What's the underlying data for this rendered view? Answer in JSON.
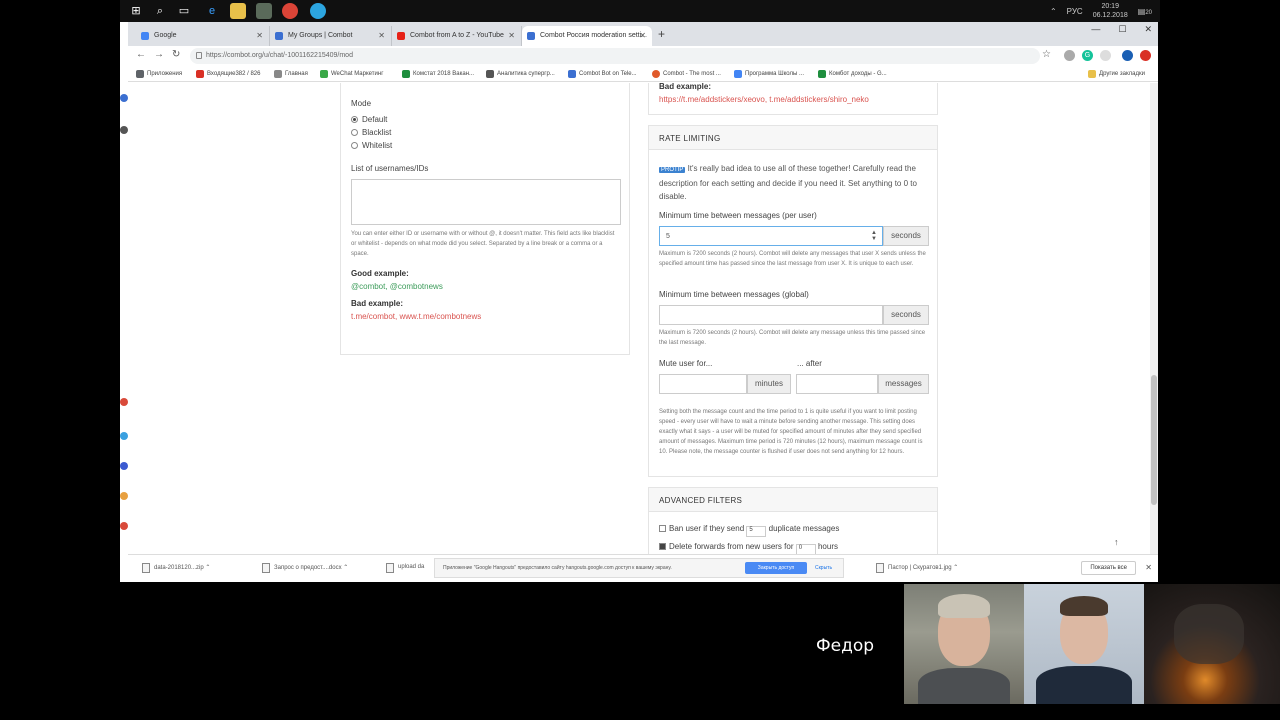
{
  "taskbar": {
    "language": "РУС",
    "time": "20:19",
    "date": "06.12.2018",
    "notifications": "20"
  },
  "browser": {
    "tabs": [
      {
        "label": "Google"
      },
      {
        "label": "My Groups | Combot"
      },
      {
        "label": "Combot from A to Z - YouTube"
      },
      {
        "label": "Combot Россия moderation setti..."
      }
    ],
    "url": "https://combot.org/u/chat/-1001162215409/mod",
    "bookmarks": [
      "Приложения",
      "Входящие382 / 826",
      "Главная",
      "WeChat Маркетинг",
      "Комстат 2018 Вакан...",
      "Аналитика супергр...",
      "Combot Bot on Tele...",
      "Combot - The most ...",
      "Программа Школы ...",
      "Комбот доходы - G...",
      "Другие закладки"
    ]
  },
  "left_panel": {
    "mode_label": "Mode",
    "modes": [
      "Default",
      "Blacklist",
      "Whitelist"
    ],
    "list_label": "List of usernames/IDs",
    "help_text": "You can enter either ID or username with or without @, it doesn't matter. This field acts like blacklist or whitelist - depends on what mode did you select. Separated by a line break or a comma or a space.",
    "good_label": "Good example:",
    "good_value": "@combot, @combotnews",
    "bad_label": "Bad example:",
    "bad_value": "t.me/combot, www.t.me/combotnews"
  },
  "right_top": {
    "bad_label": "Bad example:",
    "bad_value": "https://t.me/addstickers/xeovo, t.me/addstickers/shiro_neko"
  },
  "rate_limiting": {
    "title": "RATE LIMITING",
    "protip_badge": "PROTIP",
    "protip_text": "It's really bad idea to use all of these together! Carefully read the description for each setting and decide if you need it. Set anything to 0 to disable.",
    "per_user_label": "Minimum time between messages (per user)",
    "per_user_value": "5",
    "per_user_unit": "seconds",
    "per_user_help": "Maximum is 7200 seconds (2 hours). Combot will delete any messages that user X sends unless the specified amount time has passed since the last message from user X. It is unique to each user.",
    "global_label": "Minimum time between messages (global)",
    "global_value": "",
    "global_unit": "seconds",
    "global_help": "Maximum is 7200 seconds (2 hours). Combot will delete any message unless this time passed since the last message.",
    "mute_label": "Mute user for...",
    "after_label": "... after",
    "mute_unit": "minutes",
    "after_unit": "messages",
    "mute_help": "Setting both the message count and the time period to 1 is quite useful if you want to limit posting speed - every user will have to wait a minute before sending another message. This setting does exactly what it says - a user will be muted for specified amount of minutes after they send specified amount of messages. Maximum time period is 720 minutes (12 hours), maximum message count is 10. Please note, the message counter is flushed if user does not send anything for 12 hours."
  },
  "advanced_filters": {
    "title": "ADVANCED FILTERS",
    "ban_prefix": "Ban user if they send",
    "ban_value": "5",
    "ban_suffix": "duplicate messages",
    "forward_prefix": "Delete forwards from new users for",
    "forward_value": "0",
    "forward_suffix": "hours"
  },
  "downloads": {
    "items": [
      "data-2018120...zip",
      "Запрос о предост....docx",
      "upload da",
      "Пастор | Скуратов1.jpg"
    ],
    "hangouts_text": "Приложение \"Google Hangouts\" предоставило сайту hangouts.google.com доступ к вашему экрану.",
    "allow_label": "Закрыть доступ",
    "hide_label": "Скрыть",
    "show_all_label": "Показать все"
  },
  "video": {
    "caller_name": "Федор"
  }
}
